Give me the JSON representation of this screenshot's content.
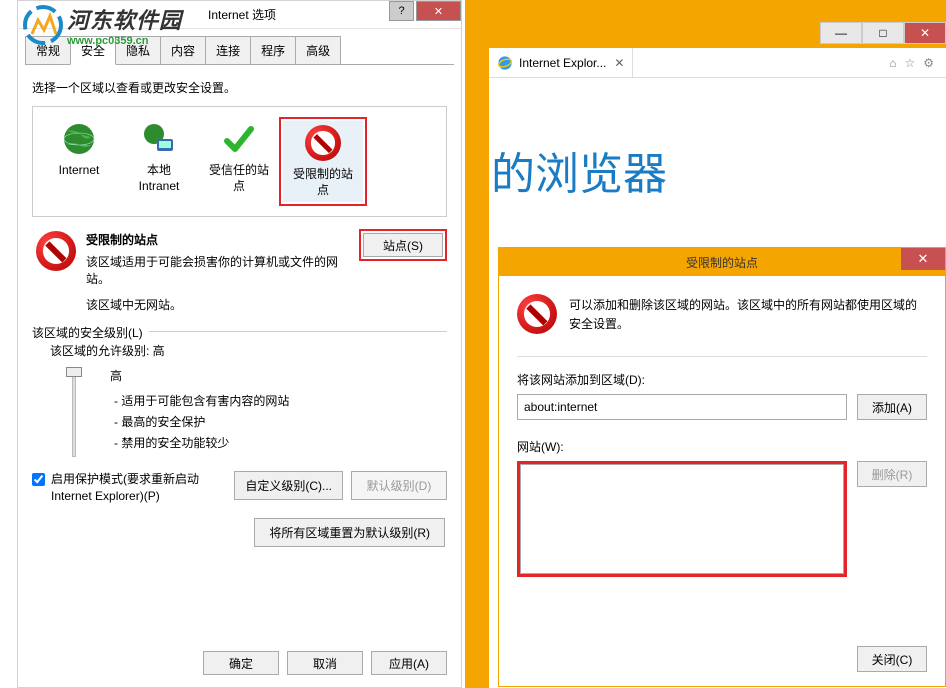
{
  "watermark": {
    "main": "河东软件园",
    "sub": "www.pc0359.cn"
  },
  "browser": {
    "tab_title": "Internet Explor...",
    "hero": "的浏览器"
  },
  "dialog": {
    "title": "Internet 选项",
    "tabs": [
      "常规",
      "安全",
      "隐私",
      "内容",
      "连接",
      "程序",
      "高级"
    ],
    "active_tab": 1,
    "instruction": "选择一个区域以查看或更改安全设置。",
    "zones": [
      {
        "label": "Internet"
      },
      {
        "label": "本地\nIntranet"
      },
      {
        "label": "受信任的站\n点"
      },
      {
        "label": "受限制的站\n点"
      }
    ],
    "selected_zone": 3,
    "zone_detail": {
      "title": "受限制的站点",
      "desc": "该区域适用于可能会损害你的计算机或文件的网站。",
      "note": "该区域中无网站。"
    },
    "sites_btn": "站点(S)",
    "sec_section": "该区域的安全级别(L)",
    "allowed_levels": "该区域的允许级别: 高",
    "level_name": "高",
    "level_bullets": [
      "- 适用于可能包含有害内容的网站",
      "- 最高的安全保护",
      "- 禁用的安全功能较少"
    ],
    "protect_label": "启用保护模式(要求重新启动 Internet Explorer)(P)",
    "custom_btn": "自定义级别(C)...",
    "default_btn": "默认级别(D)",
    "reset_btn": "将所有区域重置为默认级别(R)",
    "ok": "确定",
    "cancel": "取消",
    "apply": "应用(A)"
  },
  "sub_dialog": {
    "title": "受限制的站点",
    "header_text": "可以添加和删除该区域的网站。该区域中的所有网站都使用区域的安全设置。",
    "add_label": "将该网站添加到区域(D):",
    "add_value": "about:internet",
    "add_btn": "添加(A)",
    "list_label": "网站(W):",
    "remove_btn": "删除(R)",
    "close_btn": "关闭(C)"
  }
}
